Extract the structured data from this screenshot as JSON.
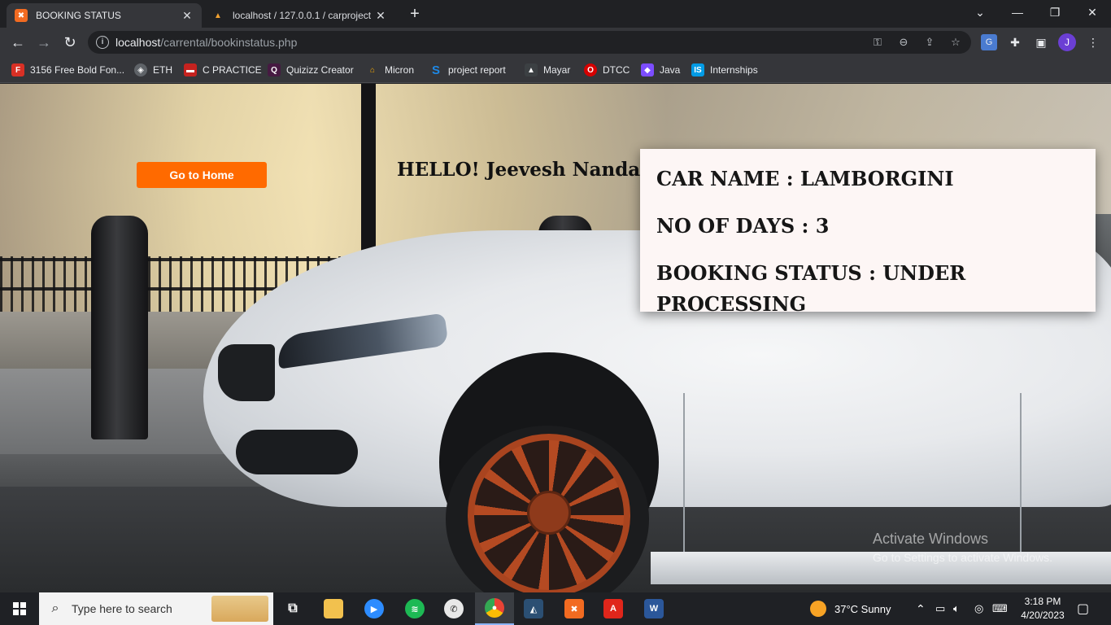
{
  "browser": {
    "tabs": [
      {
        "title": "BOOKING STATUS",
        "favicon": "xampp-icon",
        "active": true
      },
      {
        "title": "localhost / 127.0.0.1 / carproject",
        "favicon": "phpmyadmin-icon",
        "active": false
      }
    ],
    "url_host": "localhost",
    "url_path": "/carrental/bookinstatus.php",
    "avatar_letter": "J",
    "bookmarks": [
      {
        "label": "3156 Free Bold Fon...",
        "icon": "font-icon",
        "color": "#d93025"
      },
      {
        "label": "ETH",
        "icon": "eth-icon",
        "color": "#5f6368"
      },
      {
        "label": "C PRACTICE",
        "icon": "c-practice-icon",
        "color": "#c5221f"
      },
      {
        "label": "Quizizz Creator",
        "icon": "quizizz-icon",
        "color": "#461a42"
      },
      {
        "label": "Micron",
        "icon": "micron-icon",
        "color": "#1a73e8"
      },
      {
        "label": "project report",
        "icon": "s-icon",
        "color": "#1e88e5"
      },
      {
        "label": "Mayar",
        "icon": "image-icon",
        "color": "#3c4043"
      },
      {
        "label": "DTCC",
        "icon": "dtcc-icon",
        "color": "#d50000"
      },
      {
        "label": "Java",
        "icon": "java-icon",
        "color": "#7c4dff"
      },
      {
        "label": "Internships",
        "icon": "is-icon",
        "color": "#039be5"
      }
    ]
  },
  "page": {
    "home_button": "Go to Home",
    "greeting": "HELLO! Jeevesh Nandan",
    "booking": {
      "car_label": "CAR NAME : ",
      "car_value": "LAMBORGINI",
      "days_label": "NO OF DAYS : ",
      "days_value": "3",
      "status_label": "BOOKING STATUS : ",
      "status_value": "UNDER PROCESSING"
    },
    "watermark_line1": "Activate Windows",
    "watermark_line2": "Go to Settings to activate Windows."
  },
  "taskbar": {
    "search_placeholder": "Type here to search",
    "weather": "37°C  Sunny",
    "time": "3:18 PM",
    "date": "4/20/2023"
  },
  "colors": {
    "accent_button": "#ff6a00",
    "card_bg": "#fdf6f5"
  }
}
